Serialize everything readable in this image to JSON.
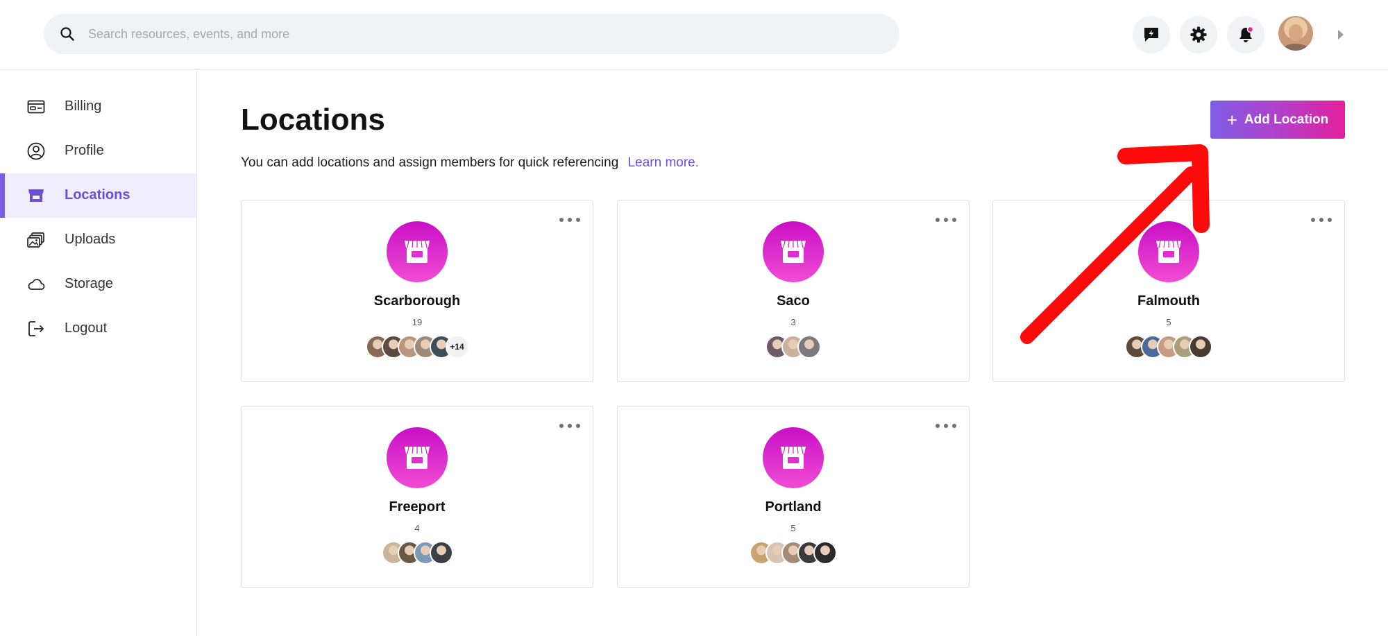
{
  "search": {
    "placeholder": "Search resources, events, and more"
  },
  "header_icons": [
    "feedback-icon",
    "gear-icon",
    "bell-icon"
  ],
  "colors": {
    "accent": "#6b4fe0",
    "store_gradient_top": "#c90fc6",
    "store_gradient_bottom": "#f04cd4",
    "button_gradient_start": "#7e5de6",
    "button_gradient_end": "#e51f9c",
    "annotation_arrow": "#ff0a0a"
  },
  "sidebar": {
    "items": [
      {
        "label": "Billing",
        "icon": "billing-icon"
      },
      {
        "label": "Profile",
        "icon": "profile-icon"
      },
      {
        "label": "Locations",
        "icon": "store-icon",
        "active": true
      },
      {
        "label": "Uploads",
        "icon": "uploads-icon"
      },
      {
        "label": "Storage",
        "icon": "cloud-icon"
      },
      {
        "label": "Logout",
        "icon": "logout-icon"
      }
    ]
  },
  "main": {
    "title": "Locations",
    "subtitle": "You can add locations and assign members for quick referencing",
    "learn_more": "Learn more.",
    "add_button": "Add Location",
    "locations": [
      {
        "name": "Scarborough",
        "count": "19",
        "avatar_colors": [
          "#8a6a55",
          "#5b4a3e",
          "#b9977d",
          "#9d8a76",
          "#3f4d5a"
        ],
        "more": "+14"
      },
      {
        "name": "Saco",
        "count": "3",
        "avatar_colors": [
          "#6d5a6a",
          "#c8b3a1",
          "#7b7b7f"
        ],
        "more": ""
      },
      {
        "name": "Falmouth",
        "count": "5",
        "avatar_colors": [
          "#5e4a3a",
          "#4a6b9a",
          "#c99b82",
          "#a8a07a",
          "#4a3b34"
        ],
        "more": ""
      },
      {
        "name": "Freeport",
        "count": "4",
        "avatar_colors": [
          "#cbb49c",
          "#6b5846",
          "#7c9ab8",
          "#3a3f48"
        ],
        "more": ""
      },
      {
        "name": "Portland",
        "count": "5",
        "avatar_colors": [
          "#c9a66f",
          "#d8c4b2",
          "#a48a78",
          "#3b3b3e",
          "#2d2a2c"
        ],
        "more": ""
      }
    ]
  }
}
